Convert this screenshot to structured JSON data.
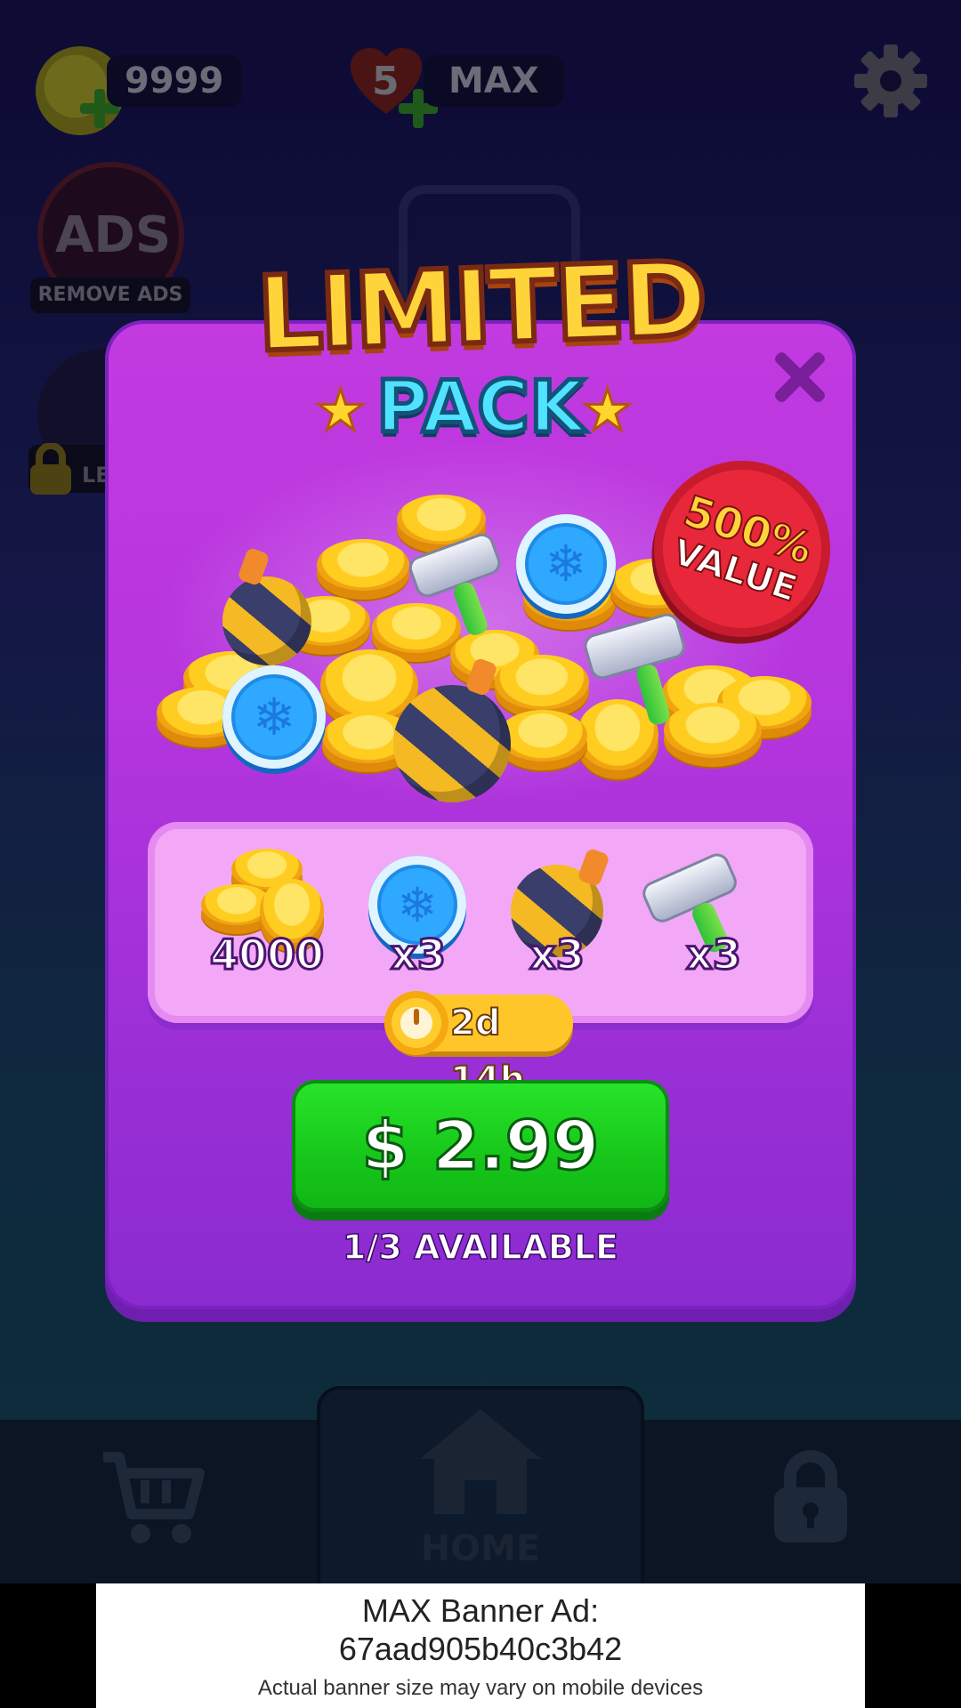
{
  "hud": {
    "coins": "9999",
    "lives": "5",
    "lives_status": "MAX"
  },
  "side_buttons": {
    "remove_ads_icon_text": "ADS",
    "remove_ads_label": "REMOVE ADS",
    "locked_label": "LE"
  },
  "popup": {
    "title_top": "LIMITED",
    "title_bottom": "PACK",
    "badge_line1": "500%",
    "badge_line2": "VALUE",
    "items": [
      {
        "icon": "coins-icon",
        "label": "4000"
      },
      {
        "icon": "freeze-icon",
        "label": "x3"
      },
      {
        "icon": "bomb-icon",
        "label": "x3"
      },
      {
        "icon": "hammer-icon",
        "label": "x3"
      }
    ],
    "timer": "2d 14h",
    "price": "$ 2.99",
    "availability": "1/3 AVAILABLE"
  },
  "nav": {
    "home_label": "HOME"
  },
  "ad_banner": {
    "title": "MAX Banner Ad:",
    "id": "67aad905b40c3b42",
    "note": "Actual banner size may vary on mobile devices"
  },
  "colors": {
    "panel": "#b535de",
    "buy_button": "#16c61a",
    "title_yellow": "#ffd43a",
    "title_cyan": "#4fe3ff",
    "badge_red": "#e8283a"
  }
}
